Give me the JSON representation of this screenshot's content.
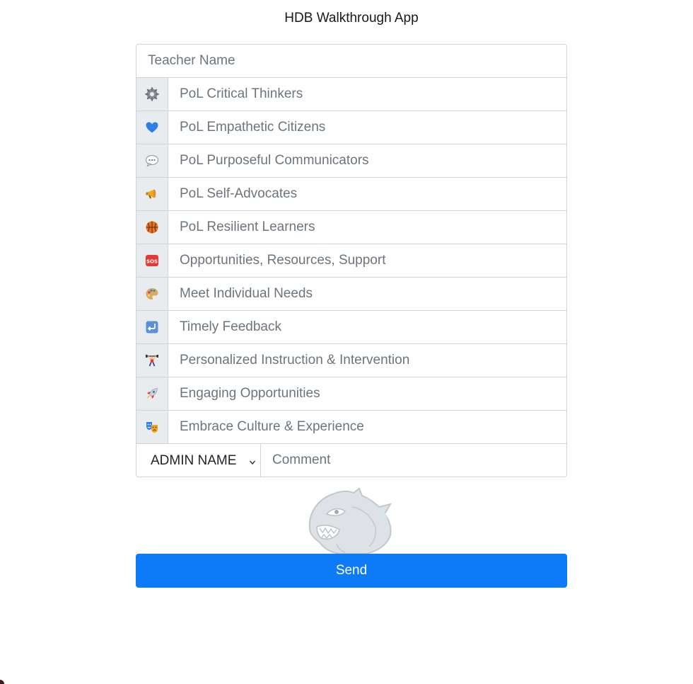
{
  "app": {
    "title": "HDB Walkthrough App"
  },
  "form": {
    "teacher_name": {
      "placeholder": "Teacher Name",
      "value": ""
    },
    "fields": [
      {
        "icon": "gear-icon",
        "placeholder": "PoL Critical Thinkers"
      },
      {
        "icon": "blue-heart-icon",
        "placeholder": "PoL Empathetic Citizens"
      },
      {
        "icon": "speech-bubble-icon",
        "placeholder": "PoL Purposeful Communicators"
      },
      {
        "icon": "megaphone-icon",
        "placeholder": "PoL Self-Advocates"
      },
      {
        "icon": "basketball-icon",
        "placeholder": "PoL Resilient Learners"
      },
      {
        "icon": "sos-icon",
        "placeholder": "Opportunities, Resources, Support"
      },
      {
        "icon": "palette-icon",
        "placeholder": "Meet Individual Needs"
      },
      {
        "icon": "return-arrow-icon",
        "placeholder": "Timely Feedback"
      },
      {
        "icon": "weightlifter-icon",
        "placeholder": "Personalized Instruction & Intervention"
      },
      {
        "icon": "rocket-icon",
        "placeholder": "Engaging Opportunities"
      },
      {
        "icon": "theater-masks-icon",
        "placeholder": "Embrace Culture & Experience"
      }
    ],
    "admin_select": {
      "selected": "ADMIN NAME"
    },
    "comment": {
      "placeholder": "Comment",
      "value": ""
    }
  },
  "logo": {
    "icon": "panther-mascot-logo"
  },
  "actions": {
    "send_label": "Send"
  },
  "colors": {
    "primary": "#0d7bf8",
    "addon_background": "#e9ecef",
    "border": "#ced4da",
    "placeholder": "#6c757d"
  }
}
